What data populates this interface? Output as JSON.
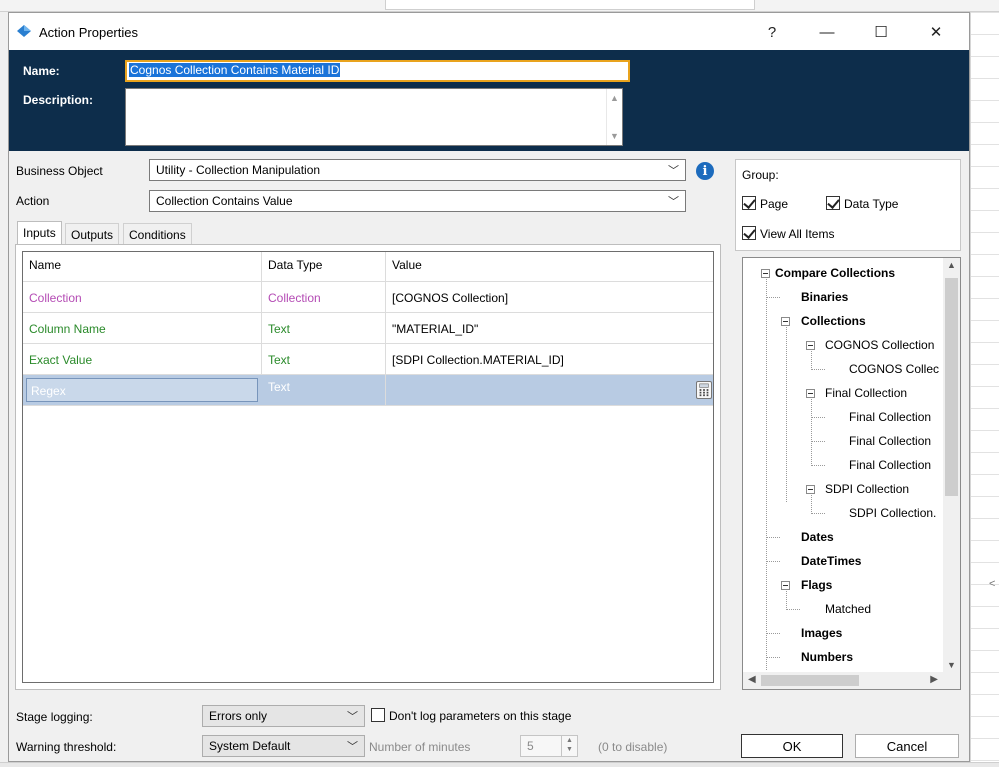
{
  "window": {
    "title": "Action Properties",
    "help_label": "?",
    "minimize_label": "—",
    "maximize_label": "☐",
    "close_label": "✕",
    "app_icon": "blueprism-diamond-icon"
  },
  "header": {
    "name_label": "Name:",
    "name_value": "Cognos Collection Contains Material ID",
    "description_label": "Description:",
    "description_value": ""
  },
  "business_object": {
    "label": "Business Object",
    "value": "Utility - Collection Manipulation"
  },
  "action": {
    "label": "Action",
    "value": "Collection Contains Value"
  },
  "tabs": [
    {
      "label": "Inputs",
      "active": true
    },
    {
      "label": "Outputs",
      "active": false
    },
    {
      "label": "Conditions",
      "active": false
    }
  ],
  "inputs_grid": {
    "columns": [
      "Name",
      "Data Type",
      "Value"
    ],
    "rows": [
      {
        "name": "Collection",
        "data_type": "Collection",
        "value": "[COGNOS Collection]",
        "color": "#b44bb4"
      },
      {
        "name": "Column Name",
        "data_type": "Text",
        "value": "\"MATERIAL_ID\"",
        "color": "#2a8a2a"
      },
      {
        "name": "Exact Value",
        "data_type": "Text",
        "value": "[SDPI Collection.MATERIAL_ID]",
        "color": "#2a8a2a"
      },
      {
        "name": "Regex",
        "data_type": "Text",
        "value": "",
        "color": "#ffffff"
      }
    ]
  },
  "group": {
    "label": "Group:",
    "page_label": "Page",
    "page_checked": true,
    "data_type_label": "Data Type",
    "data_type_checked": true,
    "view_all_label": "View All Items",
    "view_all_checked": true
  },
  "tree": {
    "items": [
      {
        "label": "Compare Collections",
        "bold": true
      },
      {
        "label": "Binaries",
        "bold": true
      },
      {
        "label": "Collections",
        "bold": true
      },
      {
        "label": "COGNOS Collection",
        "bold": false
      },
      {
        "label": "COGNOS Collec",
        "bold": false
      },
      {
        "label": "Final Collection",
        "bold": false
      },
      {
        "label": "Final Collection",
        "bold": false
      },
      {
        "label": "Final Collection",
        "bold": false
      },
      {
        "label": "Final Collection",
        "bold": false
      },
      {
        "label": "SDPI Collection",
        "bold": false
      },
      {
        "label": "SDPI Collection.",
        "bold": false
      },
      {
        "label": "Dates",
        "bold": true
      },
      {
        "label": "DateTimes",
        "bold": true
      },
      {
        "label": "Flags",
        "bold": true
      },
      {
        "label": "Matched",
        "bold": false
      },
      {
        "label": "Images",
        "bold": true
      },
      {
        "label": "Numbers",
        "bold": true
      }
    ]
  },
  "stage_logging": {
    "label": "Stage logging:",
    "value": "Errors only",
    "dont_log_label": "Don't log parameters on this stage",
    "dont_log_checked": false
  },
  "warning": {
    "label": "Warning threshold:",
    "value": "System Default",
    "minutes_label": "Number of minutes",
    "minutes_value": "5",
    "hint": "(0 to disable)"
  },
  "buttons": {
    "ok": "OK",
    "cancel": "Cancel"
  }
}
